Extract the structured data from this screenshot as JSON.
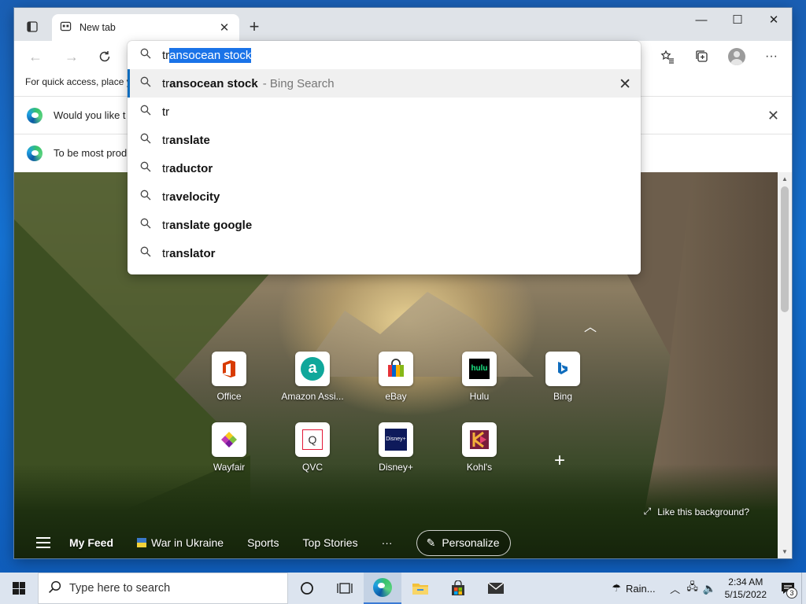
{
  "browser": {
    "tab": {
      "title": "New tab",
      "close_glyph": "✕"
    },
    "new_tab_glyph": "+",
    "window_controls": {
      "minimize": "—",
      "maximize": "☐",
      "close": "✕"
    },
    "favorites_bar_text": "For quick access, place y",
    "infobars": [
      {
        "message": "Would you like t",
        "close_glyph": "✕"
      },
      {
        "message": "To be most prod"
      }
    ]
  },
  "omnibox": {
    "typed": "tr",
    "autocomplete_selected": "ansocean stock",
    "suggestions": [
      {
        "prefix": "tr",
        "bold": "ansocean stock",
        "hint": "- Bing Search",
        "highlighted": true
      },
      {
        "prefix": "tr",
        "bold": "",
        "hint": ""
      },
      {
        "prefix": "tr",
        "bold": "anslate",
        "hint": ""
      },
      {
        "prefix": "tr",
        "bold": "aductor",
        "hint": ""
      },
      {
        "prefix": "tr",
        "bold": "avelocity",
        "hint": ""
      },
      {
        "prefix": "tr",
        "bold": "anslate google",
        "hint": ""
      },
      {
        "prefix": "tr",
        "bold": "anslator",
        "hint": ""
      }
    ],
    "remove_glyph": "✕"
  },
  "new_tab_page": {
    "quick_links": [
      {
        "label": "Office",
        "icon": "office-icon",
        "color": "#d83b01"
      },
      {
        "label": "Amazon Assi...",
        "icon": "amazon-icon",
        "color": "#10a79b"
      },
      {
        "label": "eBay",
        "icon": "ebay-icon",
        "color": "#e53238"
      },
      {
        "label": "Hulu",
        "icon": "hulu-icon",
        "color": "#1ce783"
      },
      {
        "label": "Bing",
        "icon": "bing-icon",
        "color": "#0f6cbd"
      },
      {
        "label": "Wayfair",
        "icon": "wayfair-icon",
        "color": "#7b189f"
      },
      {
        "label": "QVC",
        "icon": "qvc-icon",
        "color": "#e31837"
      },
      {
        "label": "Disney+",
        "icon": "disney-icon",
        "color": "#0e1a5b"
      },
      {
        "label": "Kohl's",
        "icon": "kohls-icon",
        "color": "#7a1e3c"
      }
    ],
    "add_glyph": "+",
    "like_background": "Like this background?",
    "feed": {
      "my_feed": "My Feed",
      "items": [
        "War in Ukraine",
        "Sports",
        "Top Stories"
      ],
      "more": "···",
      "personalize": "Personalize"
    }
  },
  "taskbar": {
    "search_placeholder": "Type here to search",
    "weather": "Rain...",
    "time": "2:34 AM",
    "date": "5/15/2022",
    "notification_count": "3"
  }
}
